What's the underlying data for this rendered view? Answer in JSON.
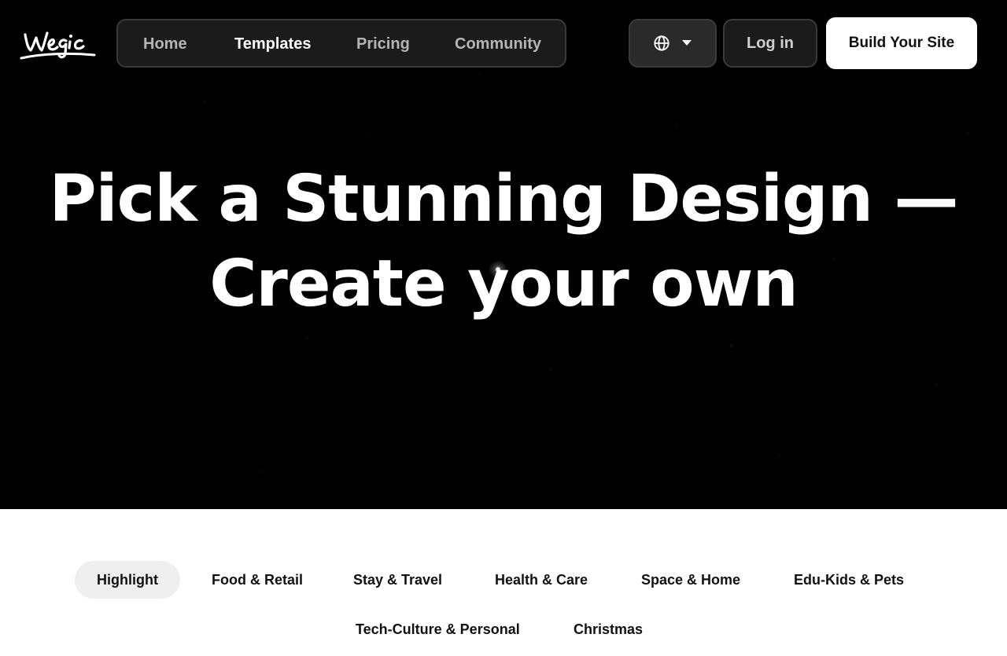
{
  "header": {
    "logo_text": "wegic",
    "nav": [
      {
        "label": "Home",
        "active": false
      },
      {
        "label": "Templates",
        "active": true
      },
      {
        "label": "Pricing",
        "active": false
      },
      {
        "label": "Community",
        "active": false
      }
    ],
    "language_icon": "globe-icon",
    "login_label": "Log in",
    "cta_label": "Build Your Site"
  },
  "hero": {
    "line1": "Pick a Stunning Design —",
    "line2": "Create your own"
  },
  "categories": {
    "items": [
      {
        "label": "Highlight",
        "active": true
      },
      {
        "label": "Food & Retail",
        "active": false
      },
      {
        "label": "Stay & Travel",
        "active": false
      },
      {
        "label": "Health & Care",
        "active": false
      },
      {
        "label": "Space & Home",
        "active": false
      },
      {
        "label": "Edu-Kids & Pets",
        "active": false
      },
      {
        "label": "Tech-Culture & Personal",
        "active": false
      },
      {
        "label": "Christmas",
        "active": false
      }
    ]
  },
  "colors": {
    "hero_bg": "#000000",
    "nav_bg": "#1b1b1b",
    "cta_bg": "#ffffff",
    "active_pill": "#efefef"
  }
}
